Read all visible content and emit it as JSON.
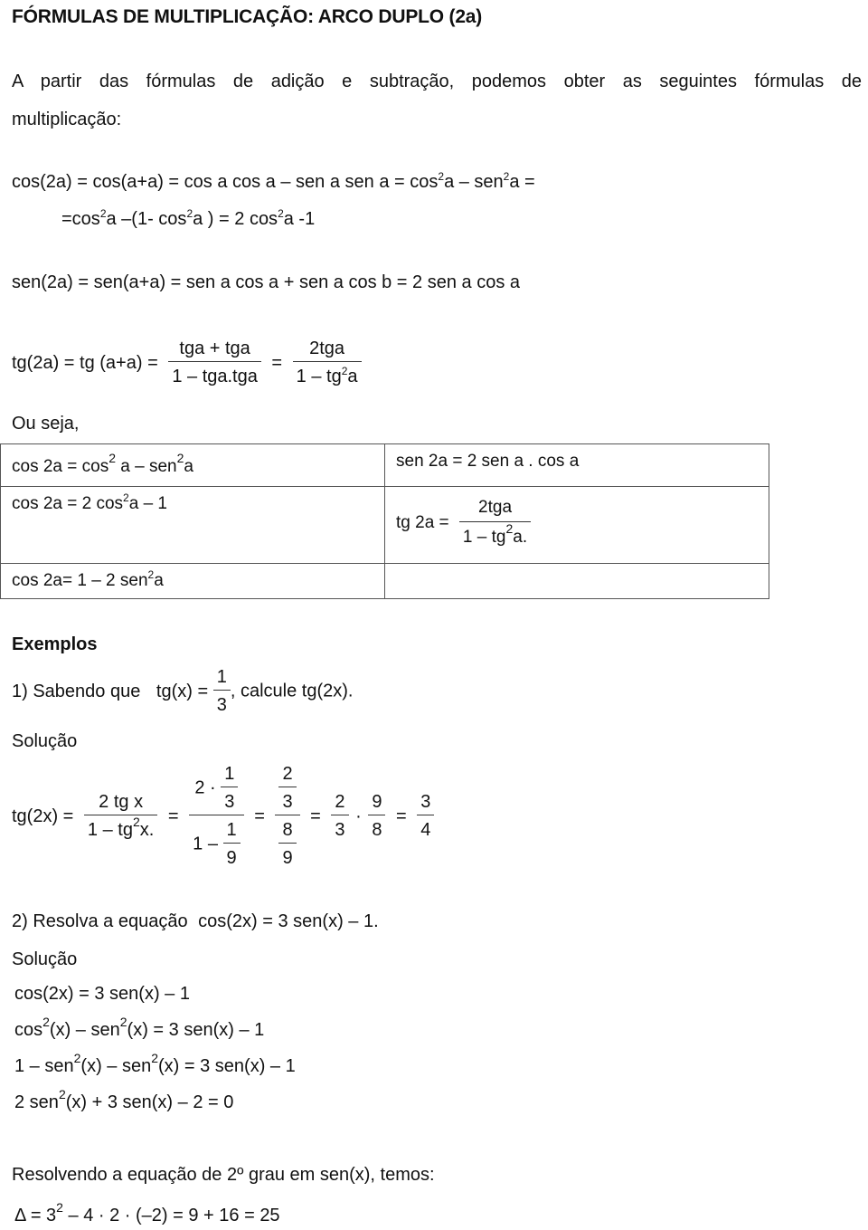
{
  "title": "FÓRMULAS DE MULTIPLICAÇÃO: ARCO DUPLO (2a)",
  "intro": {
    "line1": "A partir das fórmulas de adição e subtração, podemos obter as seguintes fórmulas de",
    "line2": "multiplicação:"
  },
  "derivations": {
    "cos_line1": {
      "a": "cos(2a) = cos(a+a) = cos a cos a – sen a sen a = cos",
      "sup1": "2",
      "b": "a – sen",
      "sup2": "2",
      "c": "a ="
    },
    "cos_line2": {
      "a": "=cos",
      "sup1": "2",
      "b": "a –(1- cos",
      "sup2": "2",
      "c": "a ) = 2 cos",
      "sup3": "2",
      "d": "a -1"
    },
    "sen_line": "sen(2a) = sen(a+a) = sen a cos a + sen a cos b = 2 sen a cos a",
    "tg_line": {
      "lhs": "tg(2a) = tg (a+a) =",
      "frac1_num": "tga + tga",
      "frac1_den": "1 – tga.tga",
      "eq": "=",
      "frac2_num": "2tga",
      "frac2_den_a": "1 – tg",
      "frac2_den_sup": "2",
      "frac2_den_b": "a"
    },
    "ou_seja": "Ou seja,"
  },
  "table": {
    "r1_left": {
      "a": "cos 2a = cos",
      "sup1": "2",
      "b": " a – sen",
      "sup2": "2",
      "c": "a"
    },
    "r1_right": "sen 2a = 2 sen a . cos a",
    "r2_left": {
      "a": "cos 2a = 2 cos",
      "sup1": "2",
      "b": "a – 1"
    },
    "r2_right": {
      "lhs": "tg 2a =",
      "num": "2tga",
      "den_a": "1 – tg",
      "den_sup": "2",
      "den_b": "a."
    },
    "r3_left": {
      "a": "cos 2a= 1 – 2 sen",
      "sup1": "2",
      "b": "a"
    },
    "r3_right": ""
  },
  "examples": {
    "heading": "Exemplos",
    "ex1": {
      "prefix": "1) Sabendo que",
      "expr": "tg(x) =",
      "num": "1",
      "den": "3",
      "suffix": ", calcule tg(2x)."
    },
    "solucao1": "Solução",
    "sol1": {
      "lhs": "tg(2x) =",
      "f1_num": "2 tg x",
      "f1_den_a": "1 – tg",
      "f1_den_sup": "2",
      "f1_den_b": "x.",
      "eq": "=",
      "f2_num_a": "2 ·",
      "f2_num_fnum": "1",
      "f2_num_fden": "3",
      "f2_den_a": "1 –",
      "f2_den_fnum": "1",
      "f2_den_fden": "9",
      "f3_num_fnum": "2",
      "f3_num_fden": "3",
      "f3_den_fnum": "8",
      "f3_den_fden": "9",
      "f4a_num": "2",
      "f4a_den": "3",
      "dot": "·",
      "f4b_num": "9",
      "f4b_den": "8",
      "f5_num": "3",
      "f5_den": "4"
    },
    "ex2": {
      "prefix": "2) Resolva a equação",
      "expr": "cos(2x) = 3 sen(x) – 1."
    },
    "solucao2": "Solução",
    "sol2": {
      "l1": "cos(2x) = 3 sen(x) – 1",
      "l2": {
        "a": "cos",
        "sup1": "2",
        "b": "(x) – sen",
        "sup2": "2",
        "c": "(x) = 3 sen(x) – 1"
      },
      "l3": {
        "a": "1 – sen",
        "sup1": "2",
        "b": "(x) – sen",
        "sup2": "2",
        "c": "(x) = 3 sen(x) – 1"
      },
      "l4": {
        "a": "2 sen",
        "sup1": "2",
        "b": "(x) + 3 sen(x) – 2 = 0"
      }
    },
    "resolvendo": "Resolvendo a equação de 2º grau em sen(x), temos:",
    "delta": {
      "a": "Δ = 3",
      "sup1": "2",
      "b": " – 4 · 2 · (–2) = 9 + 16 = 25"
    }
  }
}
